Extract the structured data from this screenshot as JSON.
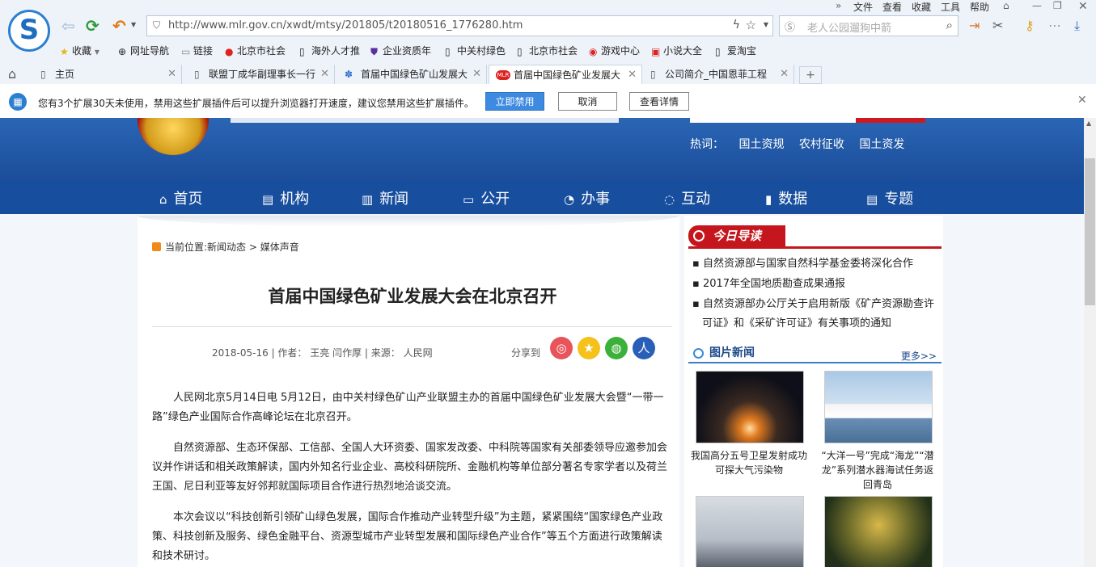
{
  "browser": {
    "url": "http://www.mlr.gov.cn/xwdt/mtsy/201805/t20180516_1776280.htm",
    "search_placeholder": "老人公园遛狗中箭",
    "menu": [
      "文件",
      "查看",
      "收藏",
      "工具",
      "帮助"
    ],
    "bookmarks": [
      "收藏",
      "网址导航",
      "链接",
      "北京市社会",
      "海外人才推",
      "企业资质年",
      "中关村绿色",
      "北京市社会",
      "游戏中心",
      "小说大全",
      "爱淘宝"
    ],
    "tabs": [
      "主页",
      "联盟丁成华副理事长一行",
      "首届中国绿色矿山发展大",
      "首届中国绿色矿业发展大",
      "公司简介_中国恩菲工程"
    ],
    "tab_logo": "MLR"
  },
  "notice": {
    "message": "您有3个扩展30天未使用，禁用这些扩展插件后可以提升浏览器打开速度，建议您禁用这些扩展插件。",
    "btn_disable": "立即禁用",
    "btn_cancel": "取消",
    "btn_details": "查看详情"
  },
  "site": {
    "hot_label": "热词：",
    "hot_words": [
      "国土资规",
      "农村征收",
      "国土资发"
    ],
    "nav": [
      {
        "label": "首页",
        "icon": "home-icon"
      },
      {
        "label": "机构",
        "icon": "org-icon"
      },
      {
        "label": "新闻",
        "icon": "book-icon"
      },
      {
        "label": "公开",
        "icon": "monitor-icon"
      },
      {
        "label": "办事",
        "icon": "person-icon"
      },
      {
        "label": "互动",
        "icon": "chat-icon"
      },
      {
        "label": "数据",
        "icon": "bar-chart-icon"
      },
      {
        "label": "专题",
        "icon": "doc-icon"
      }
    ]
  },
  "article": {
    "crumb_prefix": "当前位置:",
    "crumb_1": "新闻动态",
    "crumb_sep": ">",
    "crumb_2": "媒体声音",
    "title": "首届中国绿色矿业发展大会在北京召开",
    "date": "2018-05-16",
    "author_label": "作者：",
    "author": "王亮  闫作厚",
    "source_label": "来源：",
    "source": "人民网",
    "share_label": "分享到",
    "paragraphs": [
      "人民网北京5月14日电  5月12日，由中关村绿色矿山产业联盟主办的首届中国绿色矿业发展大会暨“一带一路”绿色产业国际合作高峰论坛在北京召开。",
      "自然资源部、生态环保部、工信部、全国人大环资委、国家发改委、中科院等国家有关部委领导应邀参加会议并作讲话和相关政策解读，国内外知名行业企业、高校科研院所、金融机构等单位部分著名专家学者以及荷兰王国、尼日利亚等友好邻邦就国际项目合作进行热烈地洽谈交流。",
      "本次会议以“科技创新引领矿山绿色发展，国际合作推动产业转型升级”为主题，紧紧围绕“国家绿色产业政策、科技创新及服务、绿色金融平台、资源型城市产业转型发展和国际绿色产业合作”等五个方面进行政策解读和技术研讨。"
    ]
  },
  "sidebar": {
    "today_label": "今日导读",
    "today_links": [
      "自然资源部与国家自然科学基金委将深化合作",
      "2017年全国地质勘查成果通报",
      "自然资源部办公厅关于启用新版《矿产资源勘查许可证》和《采矿许可证》有关事项的通知"
    ],
    "pic_news_label": "图片新闻",
    "more": "更多>>",
    "pics": [
      {
        "caption": "我国高分五号卫星发射成功 可探大气污染物"
      },
      {
        "caption": "“大洋一号”完成“海龙”“潜龙”系列潜水器海试任务返回青岛"
      },
      {
        "caption": ""
      },
      {
        "caption": ""
      }
    ]
  }
}
